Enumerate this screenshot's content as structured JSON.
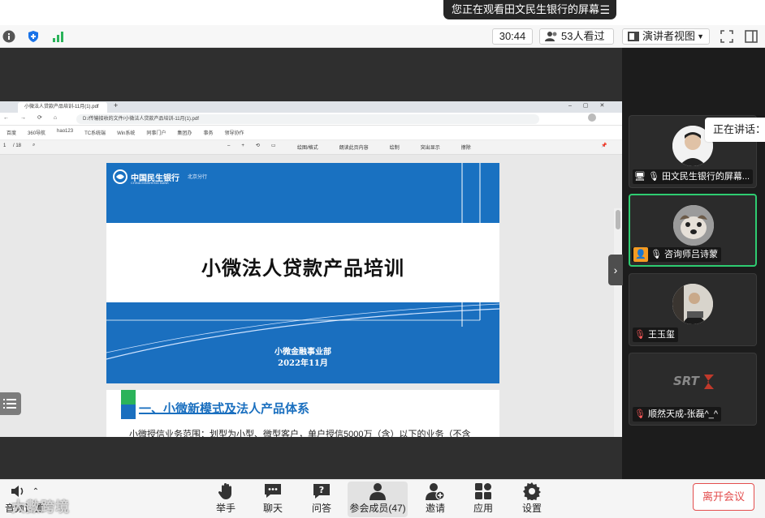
{
  "banner": {
    "share_text": "您正在观看田文民生银行的屏幕",
    "menu_icon": "hamburger-icon"
  },
  "topbar": {
    "timer": "30:44",
    "viewers": "53人看过",
    "view_mode": "演讲者视图"
  },
  "browser": {
    "tab_title": "小微法人贷款产品培训-11月(1).pdf",
    "address": "D:/传输接收的文件/小微法人贷款产品培训-11月(1).pdf",
    "bookmarks": [
      "百度",
      "360导航",
      "hao123",
      "TC系统端",
      "Win系统",
      "同事门户",
      "集团办",
      "事务",
      "领导协作"
    ],
    "pdf_page": "1",
    "pdf_total": "/ 18",
    "pdf_tools": [
      "绘图/格式",
      "朗读此页内容",
      "绘制",
      "突出显示",
      "擦除"
    ]
  },
  "slide": {
    "bank_name": "中国民生银行",
    "bank_en": "CHINA MINSHENG BANK",
    "branch": "北京分行",
    "title": "小微法人贷款产品培训",
    "dept": "小微金融事业部",
    "date": "2022年11月"
  },
  "slide2": {
    "heading": "一、小微新模式及法人产品体系",
    "text": "小微授信业务范围：划型为小型、微型客户，单户授信5000万（含）以下的业务（不含"
  },
  "panel": {
    "speaking_label": "正在讲话：咨",
    "participants": [
      {
        "name": "田文民生银行的屏幕..."
      },
      {
        "name": "咨询师吕诗蒙"
      },
      {
        "name": "王玉玺"
      },
      {
        "name": "顺然天成-张磊^_^"
      }
    ]
  },
  "bottombar": {
    "audio": "音频设置",
    "raise_hand": "举手",
    "chat": "聊天",
    "qa": "问答",
    "members": "参会成员(47)",
    "invite": "邀请",
    "apps": "应用",
    "settings": "设置",
    "leave": "离开会议",
    "watermark": "大數跨境"
  }
}
